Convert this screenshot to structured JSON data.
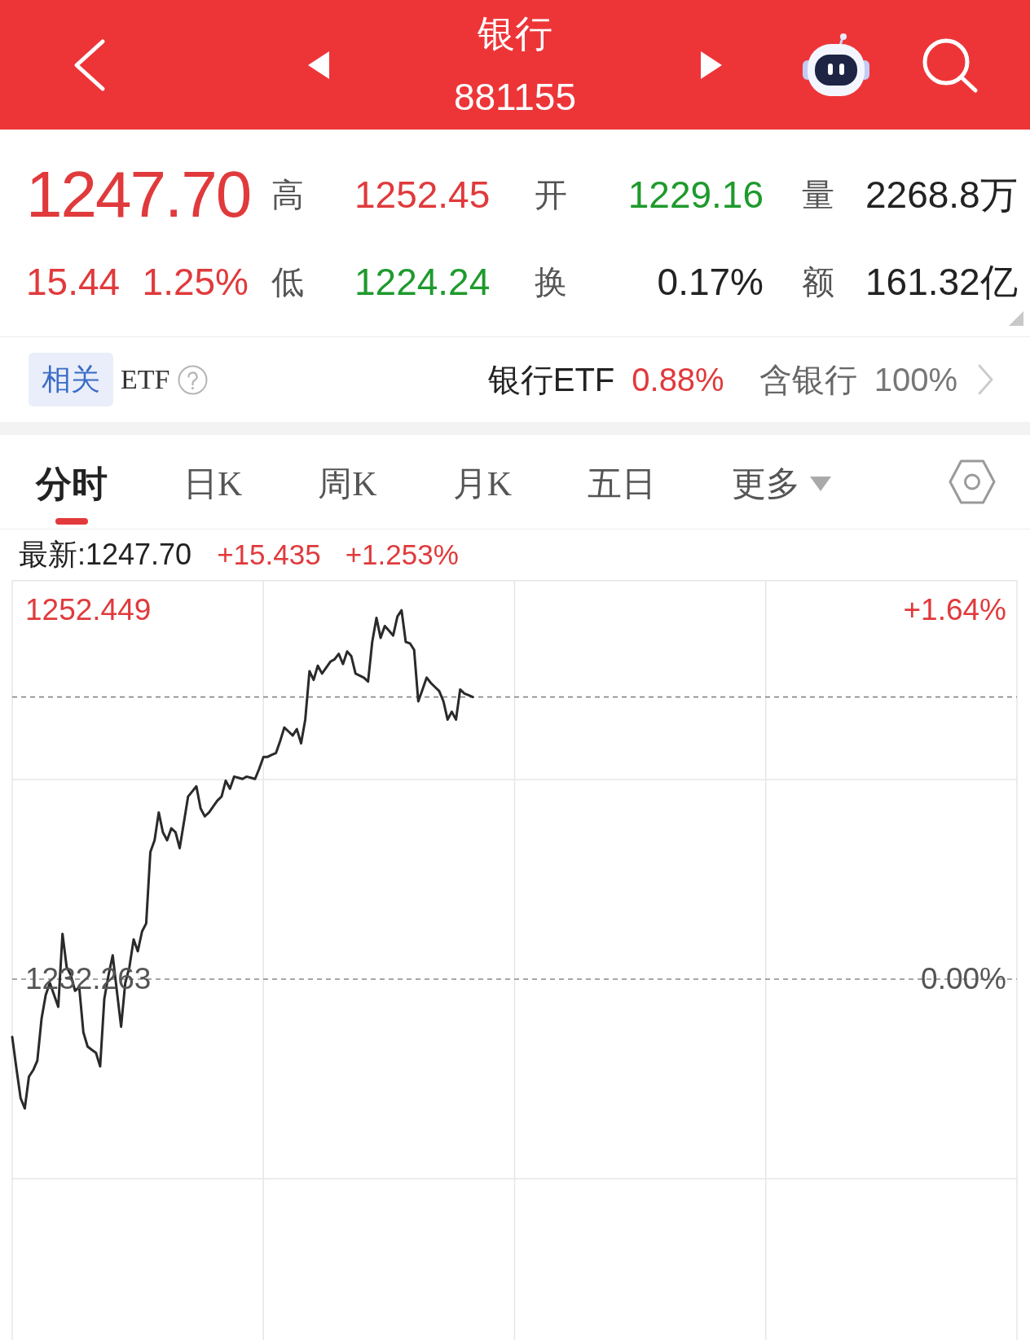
{
  "header": {
    "title": "银行",
    "code": "881155"
  },
  "quote": {
    "price": {
      "text": "1247.70",
      "color": "#e03a3c"
    },
    "change": {
      "text": "15.44",
      "color": "#e03a3c"
    },
    "change_pct": {
      "text": "1.25%",
      "color": "#e03a3c"
    },
    "stat_rows": [
      [
        {
          "label": "高",
          "value": "1252.45",
          "color": "#e03a3c"
        },
        {
          "label": "开",
          "value": "1229.16",
          "color": "#1e9a2d"
        },
        {
          "label": "量",
          "value": "2268.8万",
          "color": "#222222"
        }
      ],
      [
        {
          "label": "低",
          "value": "1224.24",
          "color": "#1e9a2d"
        },
        {
          "label": "换",
          "value": "0.17%",
          "color": "#222222"
        },
        {
          "label": "额",
          "value": "161.32亿",
          "color": "#222222"
        }
      ]
    ]
  },
  "related_etf": {
    "tag": "相关",
    "label": "ETF",
    "fund_name": "银行ETF",
    "fund_change": {
      "text": "0.88%",
      "color": "#e03a3c"
    },
    "holding_label": "含银行",
    "holding_value": "100%"
  },
  "chart_tabs": [
    {
      "label": "分时",
      "kind": "tab",
      "selected": true
    },
    {
      "label": "日K",
      "kind": "tab",
      "selected": false
    },
    {
      "label": "周K",
      "kind": "tab",
      "selected": false
    },
    {
      "label": "月K",
      "kind": "tab",
      "selected": false
    },
    {
      "label": "五日",
      "kind": "tab",
      "selected": false
    },
    {
      "label": "更多",
      "kind": "menu",
      "selected": false
    }
  ],
  "chart": {
    "latest": "最新:1247.70",
    "change": {
      "text": "+15.435",
      "color": "#e03a3c"
    },
    "change_pct": {
      "text": "+1.253%",
      "color": "#e03a3c"
    },
    "right_axis": [
      {
        "text": "+1.64%",
        "color": "#e03a3c"
      },
      {
        "text": "0.00%",
        "color": "#555555"
      }
    ],
    "chart_data": {
      "type": "line",
      "categories": [
        null,
        null,
        null,
        null,
        null,
        null,
        null,
        null,
        null,
        null,
        null,
        null,
        null,
        null,
        null,
        null,
        null,
        null,
        null,
        null,
        null,
        null,
        null,
        null,
        null,
        null,
        null,
        null,
        null,
        null,
        null,
        null,
        null,
        null,
        null,
        null,
        null,
        null,
        null,
        null,
        null,
        null,
        null,
        null,
        null,
        null,
        null,
        null,
        null,
        null,
        null,
        null,
        null,
        null,
        null,
        null,
        null,
        null,
        null,
        null,
        null,
        null,
        null,
        null,
        null,
        null,
        null,
        null,
        null,
        null,
        null,
        null,
        null,
        null,
        null,
        null,
        null,
        null,
        null,
        null,
        null,
        null,
        null,
        null,
        null,
        null,
        null,
        null,
        null,
        null,
        null,
        null,
        null,
        null,
        null,
        null,
        null,
        null,
        null,
        null,
        null,
        null,
        null,
        null,
        null,
        null,
        null,
        null,
        null,
        null,
        null,
        null,
        null,
        null,
        null,
        null,
        null,
        null,
        null,
        null,
        null,
        null,
        null,
        null,
        null,
        null,
        null,
        null,
        null,
        null,
        null,
        null,
        null,
        null,
        null,
        null,
        null,
        null,
        null,
        null,
        null,
        null,
        null,
        null,
        null,
        null,
        null,
        null,
        null,
        null,
        null,
        null,
        null,
        null,
        null,
        null,
        null,
        null,
        null,
        null,
        null,
        null,
        null,
        null,
        null,
        null,
        null,
        null,
        null,
        null,
        null,
        null,
        null,
        null,
        null,
        null,
        null,
        null,
        null,
        null,
        null,
        null,
        null,
        null,
        null,
        null,
        null,
        null,
        null,
        null,
        null,
        null,
        null,
        null,
        null,
        null,
        null,
        null,
        null,
        null,
        null,
        null,
        null,
        null,
        null,
        null,
        null,
        null,
        null,
        null,
        null,
        null,
        null,
        null,
        null,
        null,
        null,
        null,
        null,
        null,
        null,
        null,
        null,
        null,
        null,
        null,
        null,
        null,
        null,
        null,
        null,
        null,
        null,
        null,
        null,
        null,
        null,
        null,
        null,
        null,
        null
      ],
      "values": [
        1229.1,
        1227.4,
        1225.76,
        1225.19,
        1226.93,
        1227.28,
        1227.8,
        1230.1,
        1231.4,
        1232.05,
        1231.4,
        1230.75,
        1234.74,
        1232.92,
        1232.48,
        1231.62,
        1231.83,
        1229.36,
        1228.58,
        1228.4,
        1228.23,
        1227.49,
        1231.18,
        1232.48,
        1233.57,
        1231.62,
        1229.66,
        1232.05,
        1232.92,
        1234.44,
        1233.79,
        1234.87,
        1235.31,
        1239.21,
        1239.86,
        1241.38,
        1240.3,
        1239.86,
        1240.51,
        1240.3,
        1239.43,
        1240.82,
        1242.25,
        1242.53,
        1242.81,
        1241.6,
        1241.17,
        1241.38,
        1241.7,
        1242.03,
        1242.25,
        1243.12,
        1242.68,
        1243.34,
        1243.28,
        1243.21,
        1243.34,
        1243.28,
        1243.21,
        1243.77,
        1244.42,
        1244.42,
        1244.53,
        1244.64,
        1245.29,
        1246.03,
        1245.81,
        1245.59,
        1245.94,
        1245.16,
        1246.46,
        1249.11,
        1248.63,
        1249.41,
        1248.98,
        1249.3,
        1249.63,
        1249.76,
        1250.06,
        1249.5,
        1250.19,
        1249.93,
        1248.98,
        1248.87,
        1248.76,
        1248.54,
        1250.71,
        1252.02,
        1250.93,
        1251.58,
        1251.32,
        1251.06,
        1252.1,
        1252.44,
        1250.71,
        1250.63,
        1250.28,
        1247.46,
        1248.11,
        1248.76,
        1248.46,
        1248.24,
        1248.02,
        1247.46,
        1246.46,
        1246.89,
        1246.46,
        1248.11,
        1247.89,
        1247.8,
        1247.7,
        null,
        null,
        null,
        null,
        null,
        null,
        null,
        null,
        null,
        null,
        null,
        null,
        null,
        null,
        null,
        null,
        null,
        null,
        null,
        null,
        null,
        null,
        null,
        null,
        null,
        null,
        null,
        null,
        null,
        null,
        null,
        null,
        null,
        null,
        null,
        null,
        null,
        null,
        null,
        null,
        null,
        null,
        null,
        null,
        null,
        null,
        null,
        null,
        null,
        null,
        null,
        null,
        null,
        null,
        null,
        null,
        null,
        null,
        null,
        null,
        null,
        null,
        null,
        null,
        null,
        null,
        null,
        null,
        null,
        null,
        null,
        null,
        null,
        null,
        null,
        null,
        null,
        null,
        null,
        null,
        null,
        null,
        null,
        null,
        null,
        null,
        null,
        null,
        null,
        null,
        null,
        null,
        null,
        null,
        null,
        null,
        null,
        null,
        null,
        null,
        null,
        null,
        null,
        null,
        null,
        null,
        null,
        null,
        null,
        null,
        null,
        null,
        null,
        null,
        null,
        null,
        null,
        null,
        null,
        null,
        null,
        null,
        null,
        null,
        null,
        null,
        null,
        null,
        null,
        null
      ],
      "ylim": [
        1212.524,
        1254.098
      ],
      "yticks": [
        {
          "value": 1252.449,
          "label": "1252.449"
        },
        {
          "value": 1232.263,
          "label": "1232.263"
        }
      ],
      "ref_lines": [
        {
          "axis": "y",
          "value": 1247.7
        },
        {
          "axis": "y",
          "value": 1232.263
        }
      ]
    }
  }
}
